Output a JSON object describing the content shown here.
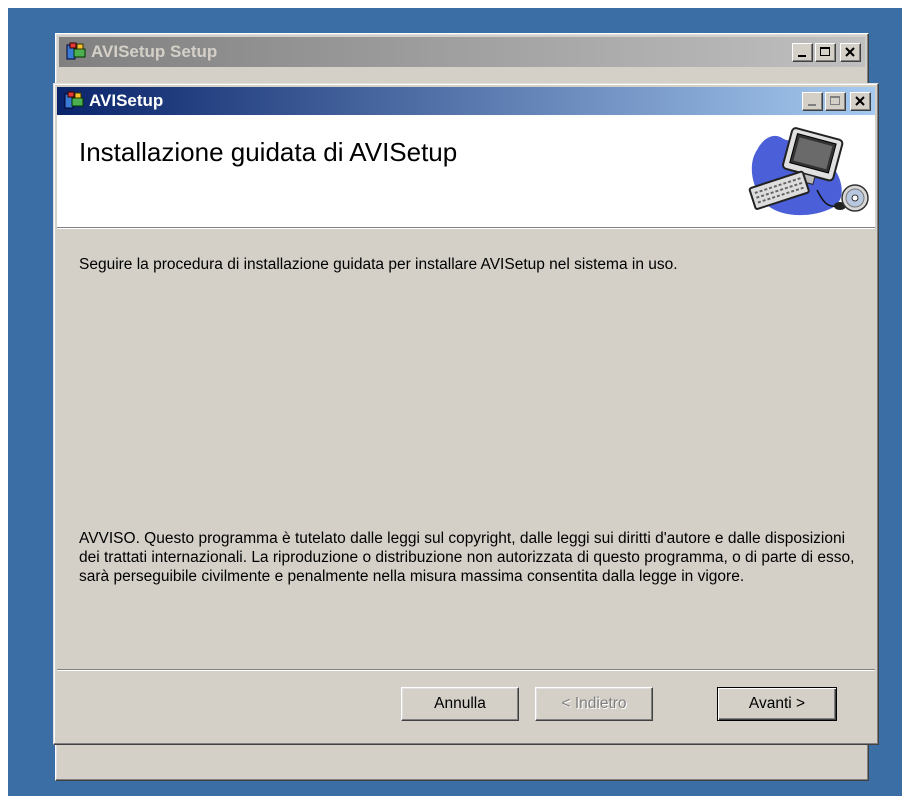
{
  "outer_window": {
    "title": "AVISetup Setup"
  },
  "dialog": {
    "title": "AVISetup",
    "banner_title": "Installazione guidata di AVISetup",
    "intro": "Seguire la procedura di installazione guidata per installare AVISetup nel sistema in uso.",
    "notice": "AVVISO. Questo programma è tutelato dalle leggi sul copyright, dalle leggi sui diritti d'autore e dalle disposizioni dei trattati internazionali. La riproduzione o distribuzione non autorizzata di questo programma, o di parte di esso, sarà perseguibile civilmente e penalmente nella misura massima consentita dalla legge in vigore.",
    "buttons": {
      "cancel": "Annulla",
      "back": "< Indietro",
      "next": "Avanti >"
    }
  },
  "icons": {
    "app_icon": "installer-icon",
    "banner_graphic": "computer-cd-icon",
    "minimize": "minimize-icon",
    "maximize": "maximize-icon",
    "close": "close-icon"
  },
  "colors": {
    "desktop": "#3a6ea5",
    "active_title_start": "#0a246a",
    "active_title_end": "#a6caf0",
    "inactive_title_start": "#808080",
    "inactive_title_end": "#c0c0c0",
    "face": "#d4d0c8"
  }
}
